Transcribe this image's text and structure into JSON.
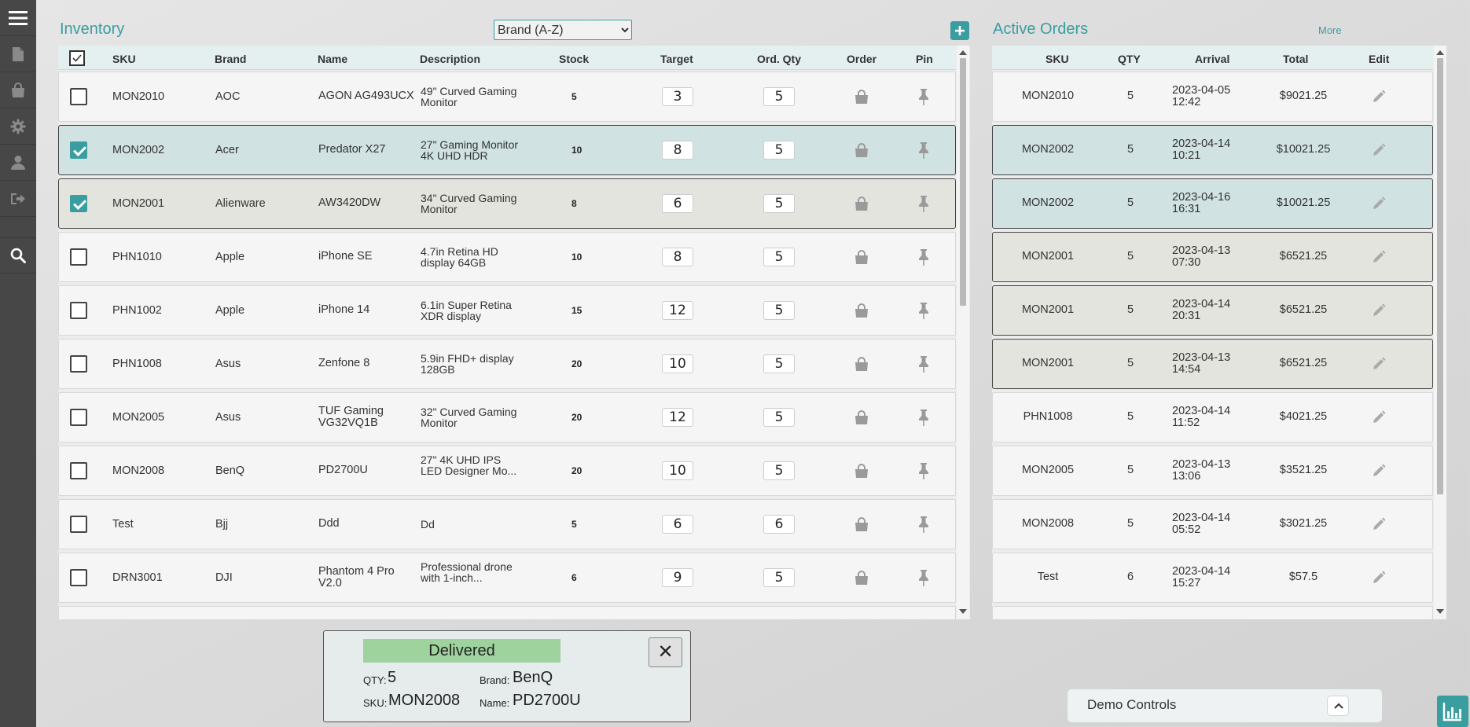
{
  "inventory": {
    "title": "Inventory",
    "sort_selected": "Brand (A-Z)",
    "columns": [
      "SKU",
      "Brand",
      "Name",
      "Description",
      "Stock",
      "Target",
      "Ord. Qty",
      "Order",
      "Pin"
    ],
    "rows": [
      {
        "sku": "MON2010",
        "brand": "AOC",
        "name": "AGON AG493UCX",
        "desc": "49\" Curved Gaming Monitor",
        "stock": "5",
        "target": "3",
        "ord_qty": "5",
        "checked": false,
        "state": ""
      },
      {
        "sku": "MON2002",
        "brand": "Acer",
        "name": "Predator X27",
        "desc": "27\" Gaming Monitor 4K UHD HDR",
        "stock": "10",
        "target": "8",
        "ord_qty": "5",
        "checked": true,
        "state": "sel-a"
      },
      {
        "sku": "MON2001",
        "brand": "Alienware",
        "name": "AW3420DW",
        "desc": "34\" Curved Gaming Monitor",
        "stock": "8",
        "target": "6",
        "ord_qty": "5",
        "checked": true,
        "state": "sel-b"
      },
      {
        "sku": "PHN1010",
        "brand": "Apple",
        "name": "iPhone SE",
        "desc": "4.7in Retina HD display 64GB",
        "stock": "10",
        "target": "8",
        "ord_qty": "5",
        "checked": false,
        "state": ""
      },
      {
        "sku": "PHN1002",
        "brand": "Apple",
        "name": "iPhone 14",
        "desc": "6.1in Super Retina XDR display",
        "stock": "15",
        "target": "12",
        "ord_qty": "5",
        "checked": false,
        "state": ""
      },
      {
        "sku": "PHN1008",
        "brand": "Asus",
        "name": "Zenfone 8",
        "desc": "5.9in FHD+ display 128GB",
        "stock": "20",
        "target": "10",
        "ord_qty": "5",
        "checked": false,
        "state": ""
      },
      {
        "sku": "MON2005",
        "brand": "Asus",
        "name": "TUF Gaming VG32VQ1B",
        "desc": "32\" Curved Gaming Monitor",
        "stock": "20",
        "target": "12",
        "ord_qty": "5",
        "checked": false,
        "state": ""
      },
      {
        "sku": "MON2008",
        "brand": "BenQ",
        "name": "PD2700U",
        "desc": "27\" 4K UHD IPS LED Designer Mo...",
        "stock": "20",
        "target": "10",
        "ord_qty": "5",
        "checked": false,
        "state": ""
      },
      {
        "sku": "Test",
        "brand": "Bjj",
        "name": "Ddd",
        "desc": "Dd",
        "stock": "5",
        "target": "6",
        "ord_qty": "6",
        "checked": false,
        "state": ""
      },
      {
        "sku": "DRN3001",
        "brand": "DJI",
        "name": "Phantom 4 Pro V2.0",
        "desc": "Professional drone with 1-inch...",
        "stock": "6",
        "target": "9",
        "ord_qty": "5",
        "checked": false,
        "state": ""
      }
    ]
  },
  "orders": {
    "title": "Active Orders",
    "more_label": "More",
    "columns": [
      "SKU",
      "QTY",
      "Arrival",
      "Total",
      "Edit"
    ],
    "rows": [
      {
        "sku": "MON2010",
        "qty": "5",
        "date": "2023-04-05",
        "time": "12:42",
        "total": "$9021.25",
        "state": ""
      },
      {
        "sku": "MON2002",
        "qty": "5",
        "date": "2023-04-14",
        "time": "10:21",
        "total": "$10021.25",
        "state": "hl-a"
      },
      {
        "sku": "MON2002",
        "qty": "5",
        "date": "2023-04-16",
        "time": "16:31",
        "total": "$10021.25",
        "state": "hl-a"
      },
      {
        "sku": "MON2001",
        "qty": "5",
        "date": "2023-04-13",
        "time": "07:30",
        "total": "$6521.25",
        "state": "hl-b"
      },
      {
        "sku": "MON2001",
        "qty": "5",
        "date": "2023-04-14",
        "time": "20:31",
        "total": "$6521.25",
        "state": "hl-b"
      },
      {
        "sku": "MON2001",
        "qty": "5",
        "date": "2023-04-13",
        "time": "14:54",
        "total": "$6521.25",
        "state": "hl-b"
      },
      {
        "sku": "PHN1008",
        "qty": "5",
        "date": "2023-04-14",
        "time": "11:52",
        "total": "$4021.25",
        "state": ""
      },
      {
        "sku": "MON2005",
        "qty": "5",
        "date": "2023-04-13",
        "time": "13:06",
        "total": "$3521.25",
        "state": ""
      },
      {
        "sku": "MON2008",
        "qty": "5",
        "date": "2023-04-14",
        "time": "05:52",
        "total": "$3021.25",
        "state": ""
      },
      {
        "sku": "Test",
        "qty": "6",
        "date": "2023-04-14",
        "time": "15:27",
        "total": "$57.5",
        "state": ""
      }
    ]
  },
  "toast": {
    "status": "Delivered",
    "close": "✕",
    "qty_label": "QTY:",
    "qty": "5",
    "brand_label": "Brand:",
    "brand": "BenQ",
    "sku_label": "SKU:",
    "sku": "MON2008",
    "name_label": "Name:",
    "name": "PD2700U"
  },
  "demo": {
    "label": "Demo Controls"
  },
  "colors": {
    "accent": "#3a9ea0",
    "sidebar": "#474747",
    "delivered": "#9ed39e"
  },
  "icons": [
    "menu-icon",
    "document-icon",
    "shopping-bag-icon",
    "gear-icon",
    "user-icon",
    "logout-icon",
    "search-icon",
    "plus-icon",
    "pin-icon",
    "pencil-icon",
    "chevron-up-icon",
    "chart-icon",
    "close-icon"
  ]
}
